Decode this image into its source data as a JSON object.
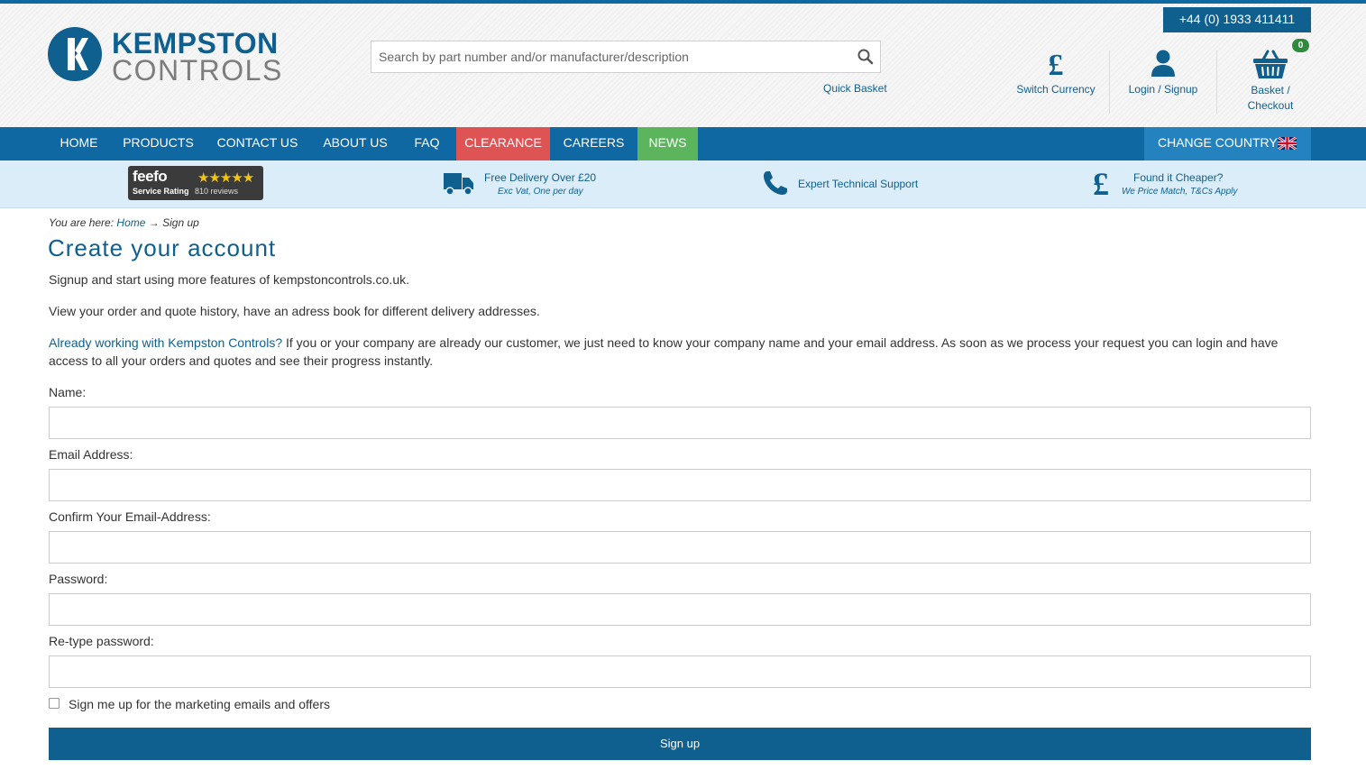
{
  "header": {
    "logo_line1": "KEMPSTON",
    "logo_line2": "CONTROLS",
    "search_placeholder": "Search by part number and/or manufacturer/description",
    "quick_basket": "Quick Basket",
    "phone": "+44 (0) 1933 411411",
    "switch_currency": "Switch Currency",
    "login_signup": "Login / Signup",
    "basket_line1": "Basket /",
    "basket_line2": "Checkout",
    "basket_count": "0"
  },
  "nav": {
    "items": [
      "HOME",
      "PRODUCTS",
      "CONTACT US",
      "ABOUT US",
      "FAQ",
      "CLEARANCE",
      "CAREERS",
      "NEWS"
    ],
    "change_country": "CHANGE COUNTRY"
  },
  "usp": {
    "feefo_logo": "feefo",
    "feefo_rating_label": "Service Rating",
    "feefo_reviews": "810 reviews",
    "feefo_stars": 4.5,
    "delivery_title": "Free Delivery Over £20",
    "delivery_sub": "Exc Vat, One per day",
    "support_title": "Expert Technical Support",
    "cheaper_title": "Found it Cheaper?",
    "cheaper_sub": "We Price Match, T&Cs Apply"
  },
  "breadcrumb": {
    "prefix": "You are here:",
    "home": "Home",
    "arrow": "→",
    "current": "Sign up"
  },
  "page": {
    "title": "Create your account",
    "intro1": "Signup and start using more features of kempstoncontrols.co.uk.",
    "intro2": "View your order and quote history, have an adress book for different delivery addresses.",
    "intro3_link": "Already working with Kempston Controls?",
    "intro3_text": " If you or your company are already our customer, we just need to know your company name and your email address. As soon as we process your request you can login and have access to all your orders and quotes and see their progress instantly."
  },
  "form": {
    "name_label": "Name:",
    "email_label": "Email Address:",
    "confirm_email_label": "Confirm Your Email-Address:",
    "password_label": "Password:",
    "retype_password_label": "Re-type password:",
    "marketing_label": "Sign me up for the marketing emails and offers",
    "marketing_checked": false,
    "submit_label": "Sign up"
  },
  "colors": {
    "brand_blue": "#0f5f8f",
    "nav_blue": "#0f68a1",
    "clearance_red": "#de5455",
    "news_green": "#5cb55c",
    "usp_bg": "#dbedf8"
  }
}
